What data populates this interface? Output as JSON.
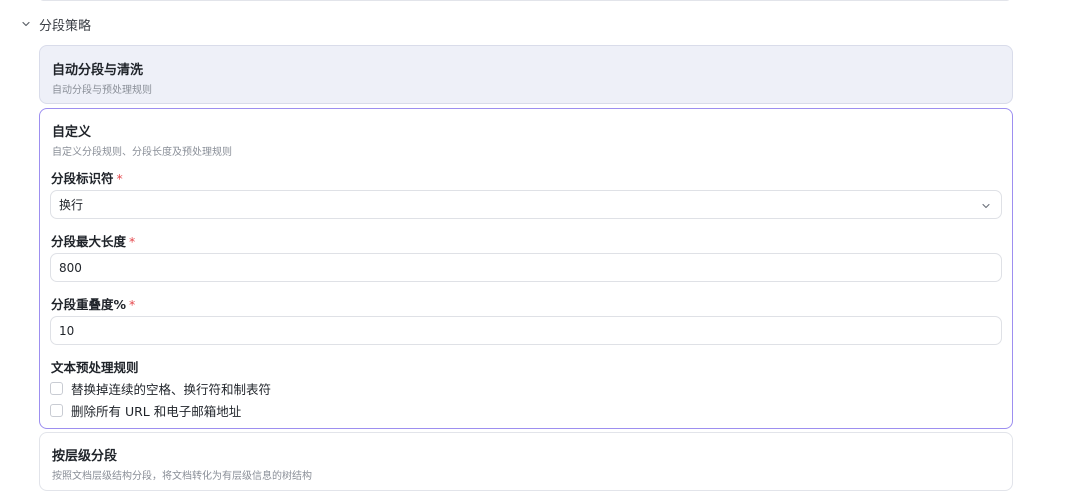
{
  "section": {
    "title": "分段策略"
  },
  "auto_option": {
    "title": "自动分段与清洗",
    "description": "自动分段与预处理规则"
  },
  "custom_option": {
    "title": "自定义",
    "description": "自定义分段规则、分段长度及预处理规则",
    "fields": {
      "separator": {
        "label": "分段标识符",
        "required_mark": "*",
        "value": "换行"
      },
      "max_length": {
        "label": "分段最大长度",
        "required_mark": "*",
        "value": "800"
      },
      "overlap": {
        "label": "分段重叠度%",
        "required_mark": "*",
        "value": "10"
      }
    },
    "preprocess": {
      "label": "文本预处理规则",
      "rules": [
        {
          "label": "替换掉连续的空格、换行符和制表符",
          "checked": false
        },
        {
          "label": "删除所有 URL 和电子邮箱地址",
          "checked": false
        }
      ]
    }
  },
  "hierarchy_option": {
    "title": "按层级分段",
    "description": "按照文档层级结构分段，将文档转化为有层级信息的树结构"
  },
  "colors": {
    "accent_border": "#9d8ff0",
    "selected_bg": "#eef0f8",
    "required": "#e5484d"
  }
}
